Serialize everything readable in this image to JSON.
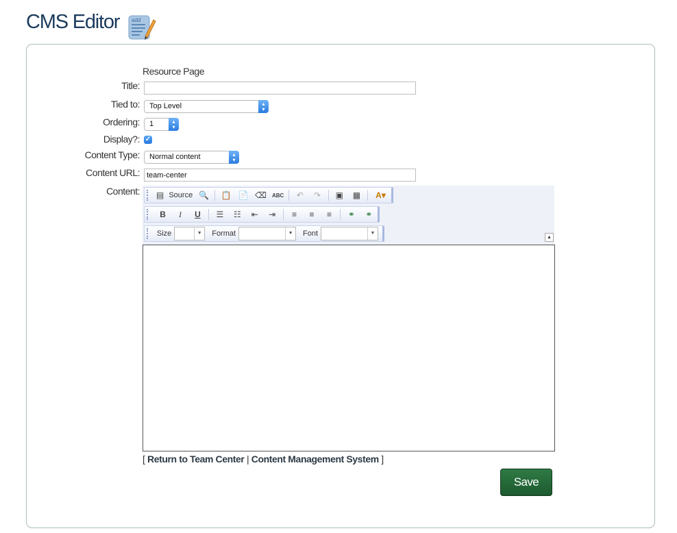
{
  "header": {
    "title": "CMS Editor",
    "icon": "notepad-pencil-icon",
    "icon_text": "add"
  },
  "form": {
    "sub_heading": "Resource Page",
    "title_label": "Title:",
    "title_value": "",
    "tied_label": "Tied to:",
    "tied_value": "Top Level",
    "ordering_label": "Ordering:",
    "ordering_value": "1",
    "display_label": "Display?:",
    "display_checked": true,
    "content_type_label": "Content Type:",
    "content_type_value": "Normal content",
    "content_url_label": "Content URL:",
    "content_url_value": "team-center",
    "content_label": "Content:"
  },
  "toolbar": {
    "source_label": "Source",
    "size_label": "Size",
    "format_label": "Format",
    "font_label": "Font",
    "spell_label": "ABC",
    "bold": "B",
    "italic": "I",
    "underline": "U"
  },
  "footer": {
    "bracket_open": "[",
    "link1": "Return to Team Center",
    "separator": "|",
    "link2": "Content Management System",
    "bracket_close": "]",
    "save_label": "Save"
  },
  "colors": {
    "title": "#1b3a5c",
    "save": "#246a38",
    "select_arrow": "#2a7be0"
  }
}
